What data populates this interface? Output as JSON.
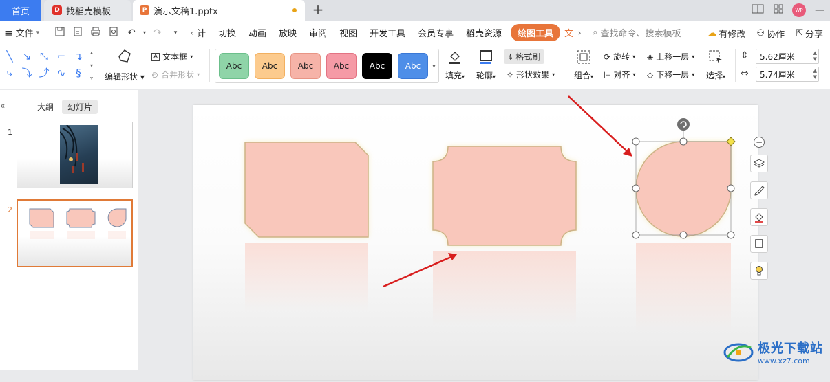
{
  "tabs": {
    "home": "首页",
    "template": "找稻壳模板",
    "doc": "演示文稿1.pptx",
    "add": "+"
  },
  "window": {
    "avatar_text": "WP",
    "minimize": "—"
  },
  "menu": {
    "file": "文件",
    "items": [
      "计",
      "切换",
      "动画",
      "放映",
      "审阅",
      "视图",
      "开发工具",
      "会员专享",
      "稻壳资源"
    ],
    "active": "绘图工具",
    "cut_item": "文",
    "search_placeholder": "查找命令、搜索模板",
    "modified": "有修改",
    "collab": "协作",
    "share": "分享"
  },
  "ribbon": {
    "edit_shape": "编辑形状",
    "text_box": "文本框",
    "merge_shape": "合并形状",
    "style_label": "Abc",
    "styles": [
      {
        "bg": "#8fd4a8",
        "border": "#6cbf8b",
        "color": "#222"
      },
      {
        "bg": "#fccb8e",
        "border": "#f2b060",
        "color": "#222"
      },
      {
        "bg": "#f6b3a8",
        "border": "#e89585",
        "color": "#222"
      },
      {
        "bg": "#f59aa6",
        "border": "#e37383",
        "color": "#222"
      },
      {
        "bg": "#000000",
        "border": "#000000",
        "color": "#fff"
      },
      {
        "bg": "#4e8ee8",
        "border": "#3a78d6",
        "color": "#fff"
      }
    ],
    "fill": "填充",
    "outline": "轮廓",
    "format_brush": "格式刷",
    "shape_effect": "形状效果",
    "group": "组合",
    "rotate": "旋转",
    "align": "对齐",
    "bring_forward": "上移一层",
    "send_backward": "下移一层",
    "select": "选择",
    "height": "5.62厘米",
    "width": "5.74厘米"
  },
  "left_panel": {
    "collapse": "«",
    "outline_tab": "大纲",
    "slides_tab": "幻灯片",
    "slide1_num": "1",
    "slide2_num": "2"
  },
  "colors": {
    "shape_fill": "#f9c7bb",
    "shape_stroke": "#cdb386",
    "glow": "#f3e19a",
    "accent": "#e8753a",
    "arrow": "#d81e1e"
  },
  "watermark": {
    "title": "极光下载站",
    "url": "www.xz7.com"
  }
}
